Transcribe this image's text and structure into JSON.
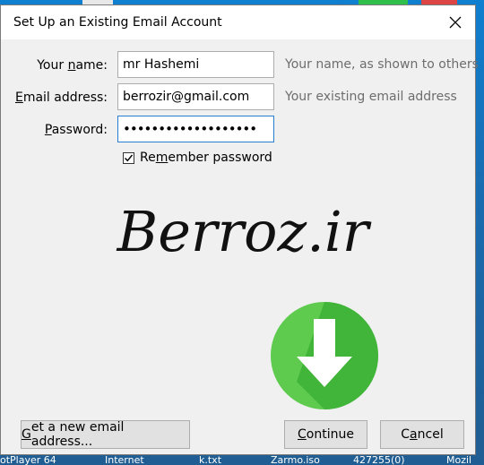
{
  "dialog": {
    "title": "Set Up an Existing Email Account",
    "name_label_prefix": "Your ",
    "name_label_key": "n",
    "name_label_suffix": "ame:",
    "name_value": "mr Hashemi",
    "name_hint": "Your name, as shown to others",
    "email_label_key": "E",
    "email_label_suffix": "mail address:",
    "email_value": "berrozir@gmail.com",
    "email_hint": "Your existing email address",
    "password_label_key": "P",
    "password_label_suffix": "assword:",
    "password_mask": "•••••••••••••••••••",
    "remember_prefix": "Re",
    "remember_key": "m",
    "remember_suffix": "ember password",
    "remember_checked": true,
    "watermark_text": "Berroz.ir",
    "get_new_prefix": "",
    "get_new_key": "G",
    "get_new_suffix": "et a new email address...",
    "continue_key": "C",
    "continue_suffix": "ontinue",
    "cancel_prefix": "C",
    "cancel_key": "a",
    "cancel_suffix": "ncel"
  },
  "taskbar": {
    "items": [
      "otPlayer 64",
      "Internet",
      "k.txt",
      "Zarmo.iso",
      "427255(0)",
      "Mozil"
    ]
  },
  "colors": {
    "focus_border": "#2a7fd4",
    "download_green": "#5ecb4f",
    "download_dark": "#3aae35"
  }
}
